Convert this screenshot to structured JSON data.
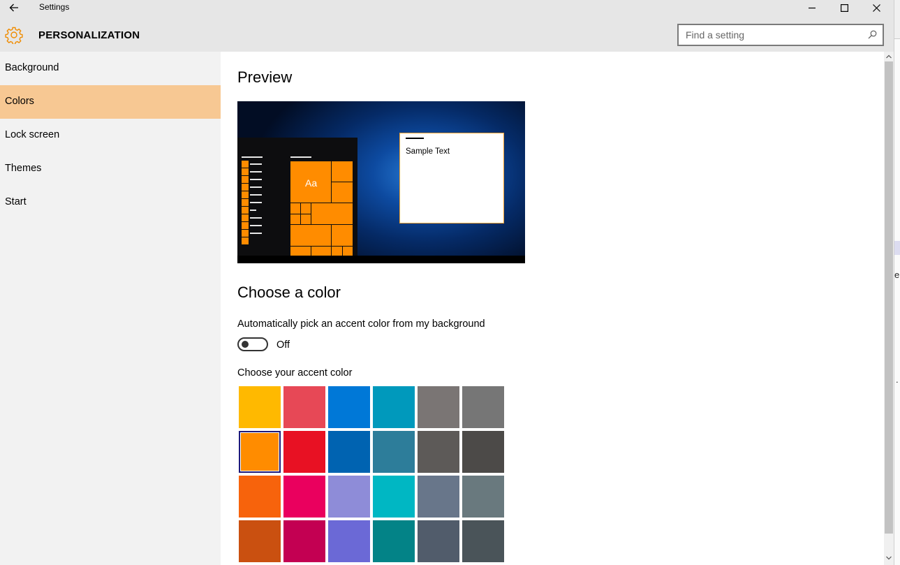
{
  "window": {
    "title": "Settings",
    "back_icon": "arrow-left",
    "minimize_icon": "minimize",
    "maximize_icon": "maximize",
    "close_icon": "close"
  },
  "header": {
    "icon": "gear",
    "title": "PERSONALIZATION",
    "search_placeholder": "Find a setting",
    "search_icon": "magnifier"
  },
  "sidebar": {
    "items": [
      {
        "label": "Background",
        "active": false
      },
      {
        "label": "Colors",
        "active": true
      },
      {
        "label": "Lock screen",
        "active": false
      },
      {
        "label": "Themes",
        "active": false
      },
      {
        "label": "Start",
        "active": false
      }
    ],
    "active_color": "#f7c893"
  },
  "main": {
    "preview_title": "Preview",
    "preview": {
      "sample_text": "Sample Text",
      "tile_label": "Aa",
      "accent": "#ff8c00"
    },
    "choose_title": "Choose a color",
    "auto_accent_label": "Automatically pick an accent color from my background",
    "auto_accent_toggle": {
      "state": "Off"
    },
    "accent_label": "Choose your accent color",
    "accent_colors": [
      [
        "#ffb900",
        "#e74856",
        "#0078d7",
        "#0099bc",
        "#7a7574",
        "#767676"
      ],
      [
        "#ff8c00",
        "#e81123",
        "#0063b1",
        "#2d7d9a",
        "#5d5a58",
        "#4c4a48"
      ],
      [
        "#f7630c",
        "#ea005e",
        "#8e8cd8",
        "#00b7c3",
        "#68768a",
        "#69797e"
      ],
      [
        "#ca5010",
        "#c30052",
        "#6b69d6",
        "#038387",
        "#515c6b",
        "#4a5459"
      ]
    ],
    "selected_accent": "#ff8c00"
  }
}
